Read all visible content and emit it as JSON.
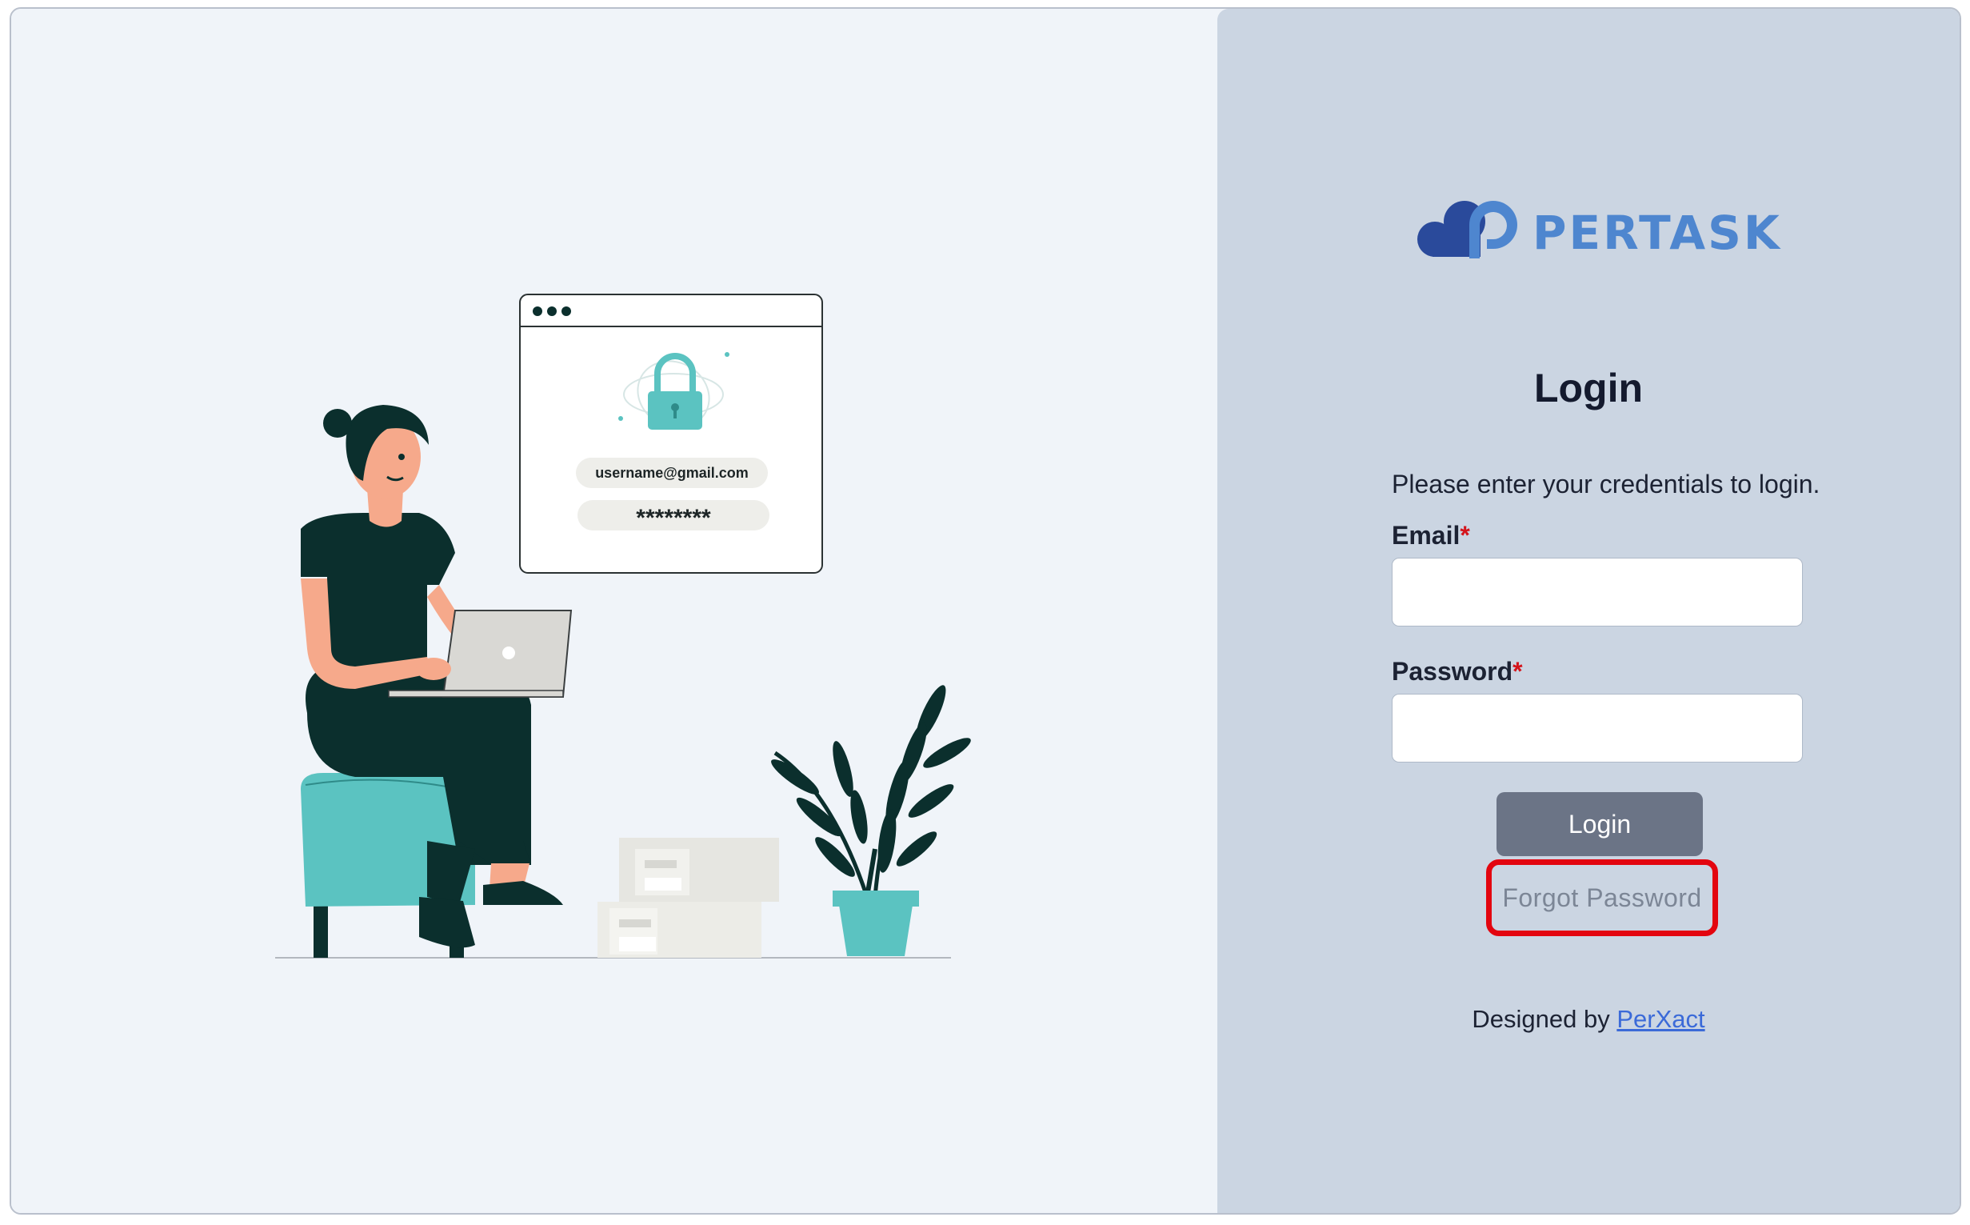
{
  "illustration": {
    "email_text": "username@gmail.com",
    "password_text": "********"
  },
  "logo": {
    "text": "PERTASK"
  },
  "form": {
    "title": "Login",
    "subtitle": "Please enter your credentials to login.",
    "email_label": "Email",
    "password_label": "Password",
    "required_mark": "*",
    "email_value": "",
    "password_value": "",
    "login_button": "Login",
    "forgot_password": "Forgot Password"
  },
  "footer": {
    "designed_by": "Designed by",
    "link_text": "PerXact"
  },
  "colors": {
    "accent": "#4e86cf",
    "button": "#6b7486",
    "highlight": "#e3050f",
    "link": "#3b6ad8"
  }
}
